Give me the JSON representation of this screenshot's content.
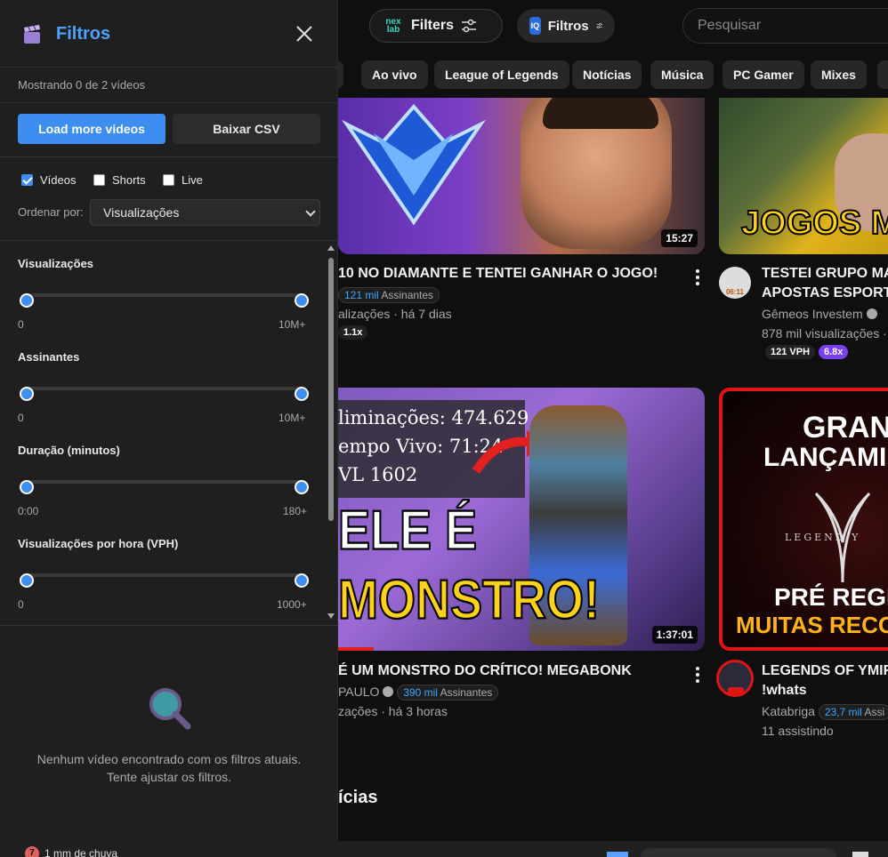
{
  "panel": {
    "title": "Filtros",
    "showing": "Mostrando 0 de 2 vídeos",
    "load_more": "Load more videos",
    "download_csv": "Baixar CSV",
    "types": [
      {
        "label": "Vídeos",
        "checked": true
      },
      {
        "label": "Shorts",
        "checked": false
      },
      {
        "label": "Live",
        "checked": false
      }
    ],
    "sort_label": "Ordenar por:",
    "sort_value": "Visualizações",
    "filters": [
      {
        "title": "Visualizações",
        "min_label": "0",
        "max_label": "10M+"
      },
      {
        "title": "Assinantes",
        "min_label": "0",
        "max_label": "10M+"
      },
      {
        "title": "Duração (minutos)",
        "min_label": "0:00",
        "max_label": "180+"
      },
      {
        "title": "Visualizações por hora (VPH)",
        "min_label": "0",
        "max_label": "1000+"
      }
    ],
    "empty_line1": "Nenhum vídeo encontrado com os filtros atuais.",
    "empty_line2": "Tente ajustar os filtros."
  },
  "header": {
    "ext1_logo": "nex lab",
    "ext1_label": "Filters",
    "ext2_logo": "IQ",
    "ext2_label": "Filtros",
    "search_placeholder": "Pesquisar"
  },
  "chips": [
    "s",
    "Ao vivo",
    "League of Legends",
    "Notícias",
    "Música",
    "PC Gamer",
    "Mixes"
  ],
  "videos": [
    {
      "thumb_duration": "15:27",
      "title": "10 NO DIAMANTE E TENTEI GANHAR O JOGO!",
      "subs_count": "121 mil",
      "subs_word": "Assinantes",
      "meta": "alizações · há 7 dias",
      "ratio": "1.1x"
    },
    {
      "thumb_text": "JOGOS M",
      "title_line1": "TESTEI GRUPO MAN",
      "title_line2": "APOSTAS ESPORTIV",
      "channel": "Gêmeos Investem",
      "meta": "878 mil visualizações ·",
      "vph": "121 VPH",
      "ratio": "6.8x",
      "avatar_time": "06:11"
    },
    {
      "thumb_duration": "1:37:01",
      "thumb_line1": "liminações: 474.629",
      "thumb_line2": "empo Vivo: 71:24",
      "thumb_line3": "VL 1602",
      "thumb_big1": "ELE É",
      "thumb_big2": "MONSTRO!",
      "title": "É UM MONSTRO DO CRÍTICO! MEGABONK",
      "channel": "PAULO",
      "subs_count": "390 mil",
      "subs_word": "Assinantes",
      "meta": "zações · há 3 horas"
    },
    {
      "thumb_line1": "GRAN",
      "thumb_line2": "LANÇAMI",
      "thumb_legend": "LEGEND    Y",
      "thumb_line3": "PRÉ REGIS",
      "thumb_line4": "MUITAS RECOM",
      "title_line1": "LEGENDS OF YMIR",
      "title_line2": "!whats",
      "channel": "Katabriga",
      "subs_count": "23,7 mil",
      "subs_word": "Assi",
      "meta": "11 assistindo"
    }
  ],
  "section_title": "ícias",
  "taskbar": {
    "weather_badge": "7",
    "weather_text": "1 mm de chuva"
  },
  "colors": {
    "accent": "#3d8ef0",
    "panel_bg": "#1f1f1f",
    "page_bg": "#0f0f0f",
    "title_blue": "#4ea1ff"
  }
}
